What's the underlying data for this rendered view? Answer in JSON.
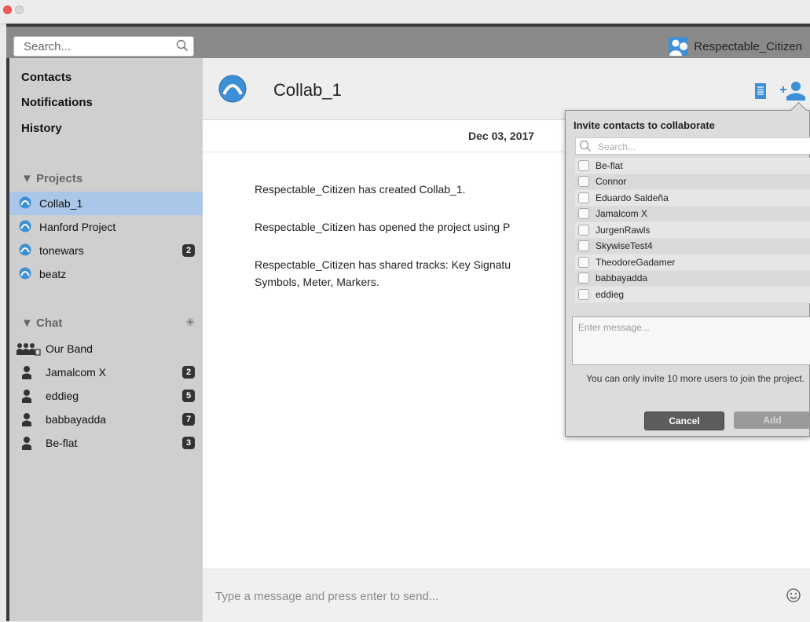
{
  "window": {
    "controls": [
      "close",
      "minimize"
    ]
  },
  "search": {
    "placeholder": "Search..."
  },
  "user": {
    "name": "Respectable_Citizen"
  },
  "nav": {
    "contacts": "Contacts",
    "notifications": "Notifications",
    "history": "History"
  },
  "projects": {
    "header": "▼ Projects",
    "items": [
      {
        "label": "Collab_1",
        "selected": true
      },
      {
        "label": "Hanford Project"
      },
      {
        "label": "tonewars",
        "badge": "2"
      },
      {
        "label": "beatz"
      }
    ]
  },
  "chat": {
    "header": "▼ Chat",
    "items": [
      {
        "label": "Our Band",
        "group": true
      },
      {
        "label": "Jamalcom X",
        "badge": "2"
      },
      {
        "label": "eddieg",
        "badge": "5"
      },
      {
        "label": "babbayadda",
        "badge": "7"
      },
      {
        "label": "Be-flat",
        "badge": "3"
      }
    ]
  },
  "conversation": {
    "title": "Collab_1",
    "date": "Dec 03, 2017",
    "messages": [
      "Respectable_Citizen has created Collab_1.",
      "Respectable_Citizen has opened the project using P",
      "Respectable_Citizen has shared tracks: Key Signatu\nSymbols, Meter, Markers."
    ],
    "composer_placeholder": "Type a message and press enter to send..."
  },
  "invite": {
    "title": "Invite contacts to collaborate",
    "search_placeholder": "Search...",
    "contacts": [
      "Be-flat",
      "Connor",
      "Eduardo Saldeña",
      "Jamalcom X",
      "JurgenRawls",
      "SkywiseTest4",
      "TheodoreGadamer",
      "babbayadda",
      "eddieg"
    ],
    "message_placeholder": "Enter message...",
    "note": "You can only invite 10 more users to join the project.",
    "cancel": "Cancel",
    "add": "Add"
  },
  "colors": {
    "accent": "#3d8fd6",
    "selection": "#aac6e8"
  }
}
